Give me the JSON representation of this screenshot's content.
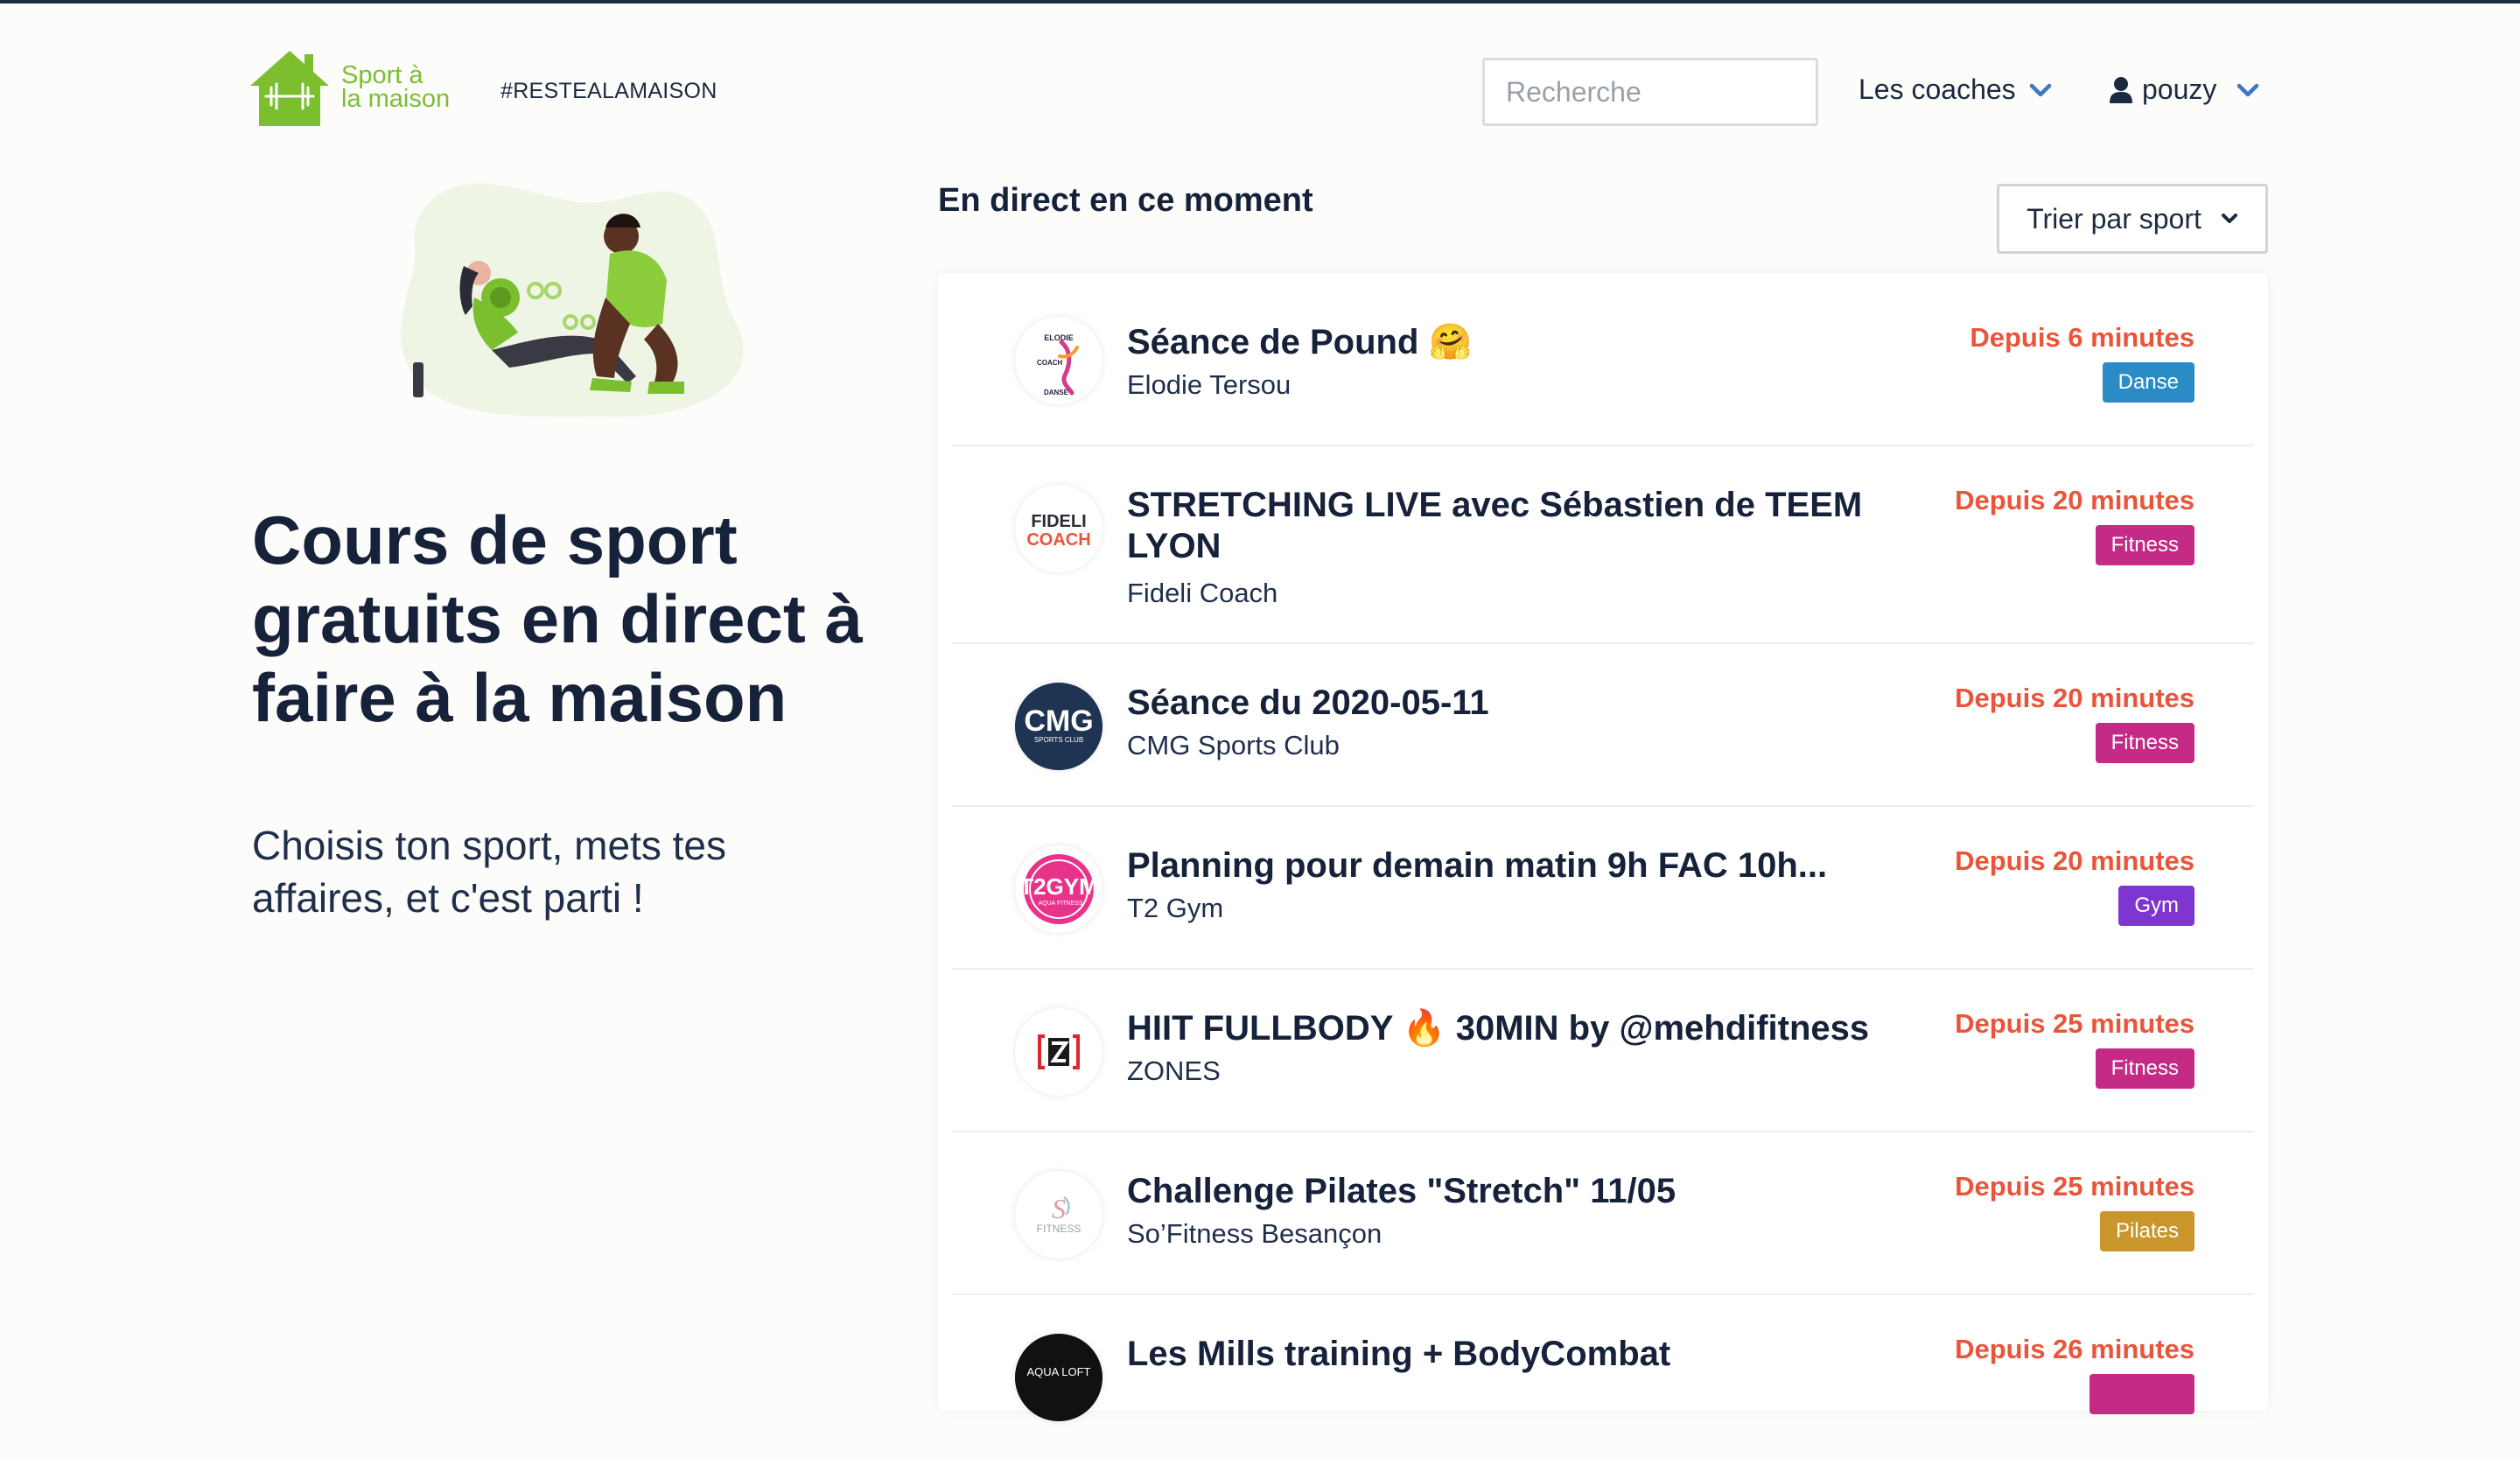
{
  "header": {
    "logo_line1": "Sport à",
    "logo_line2": "la maison",
    "hashtag": "#RESTEALAMAISON",
    "search_placeholder": "Recherche",
    "nav_coaches": "Les coaches",
    "user_name": "pouzy"
  },
  "hero": {
    "title": "Cours de sport gratuits en direct à faire à la maison",
    "subtitle": "Choisis ton sport, mets tes affaires, et c'est parti !"
  },
  "live": {
    "section_title": "En direct en ce moment",
    "sort_label": "Trier par sport",
    "items": [
      {
        "title": "Séance de Pound 🤗",
        "coach": "Elodie Tersou",
        "since": "Depuis 6 minutes",
        "sport": "Danse",
        "sport_color": "#2a8bc5"
      },
      {
        "title": "STRETCHING LIVE avec Sébastien de TEEM LYON",
        "coach": "Fideli Coach",
        "since": "Depuis 20 minutes",
        "sport": "Fitness",
        "sport_color": "#c42a86"
      },
      {
        "title": "Séance du 2020-05-11",
        "coach": "CMG Sports Club",
        "since": "Depuis 20 minutes",
        "sport": "Fitness",
        "sport_color": "#c42a86"
      },
      {
        "title": "Planning pour demain matin 9h FAC 10h...",
        "coach": "T2 Gym",
        "since": "Depuis 20 minutes",
        "sport": "Gym",
        "sport_color": "#7f35cf"
      },
      {
        "title": "HIIT FULLBODY 🔥 30MIN by @mehdifitness",
        "coach": "ZONES",
        "since": "Depuis 25 minutes",
        "sport": "Fitness",
        "sport_color": "#c42a86"
      },
      {
        "title": "Challenge Pilates \"Stretch\" 11/05",
        "coach": "So’Fitness Besançon",
        "since": "Depuis 25 minutes",
        "sport": "Pilates",
        "sport_color": "#c8962a"
      },
      {
        "title": "Les Mills training + BodyCombat",
        "coach": "",
        "since": "Depuis 26 minutes",
        "sport": "",
        "sport_color": "#c42a86"
      }
    ]
  },
  "colors": {
    "accent_green": "#7bbf2f",
    "live_orange": "#e9553a",
    "navy": "#16213a"
  }
}
